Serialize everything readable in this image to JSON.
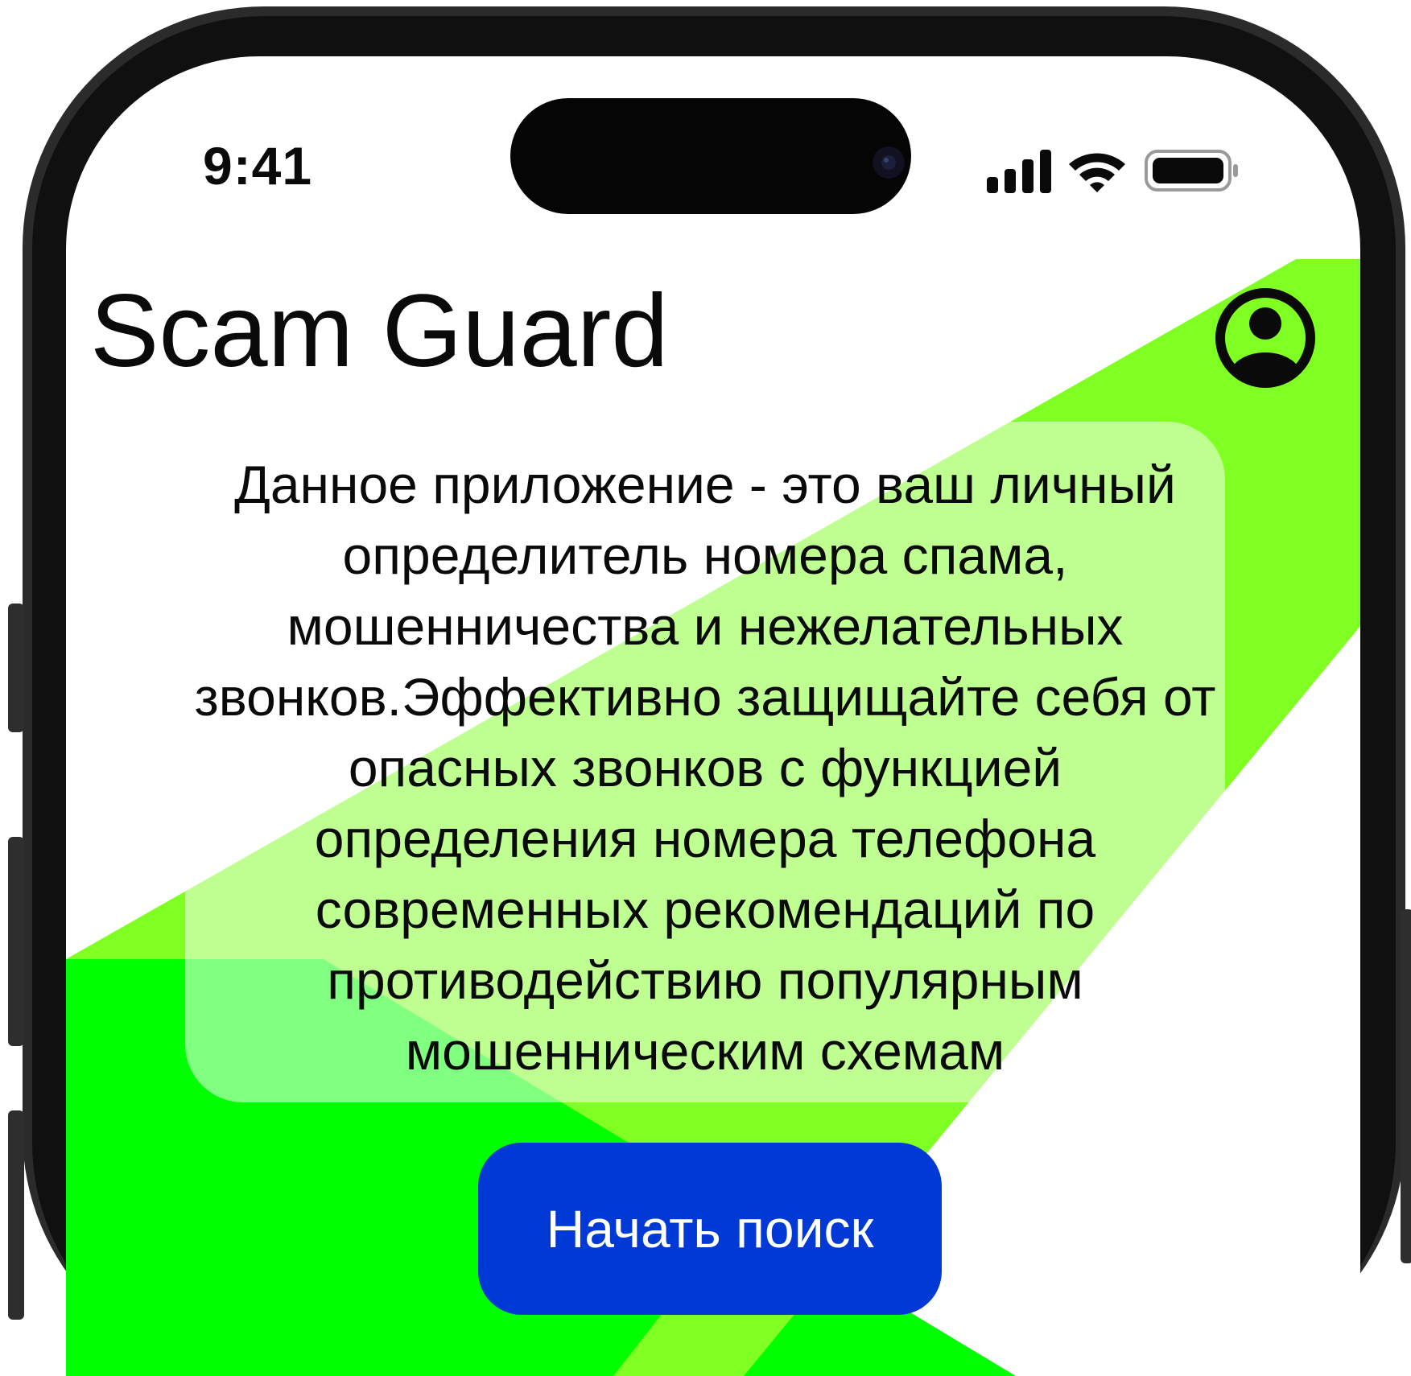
{
  "status_bar": {
    "time": "9:41",
    "icons": [
      "cellular-signal-icon",
      "wifi-icon",
      "battery-icon"
    ]
  },
  "app": {
    "title": "Scam Guard",
    "profile_icon": "user-circle-icon"
  },
  "description": "Данное приложение - это ваш личный определитель номера спама, мошенничества и нежелательных звонков.Эффективно защищайте себя от опасных звонков с функцией определения номера телефона современных рекомендаций по противодействию популярным мошенническим схемам",
  "cta": {
    "label": "Начать поиск"
  },
  "colors": {
    "brand_green": "#7FFF22",
    "bright_green": "#00FF00",
    "button_blue": "#0039D6",
    "text": "#0A0A0A",
    "frame": "#2A2A2A"
  }
}
